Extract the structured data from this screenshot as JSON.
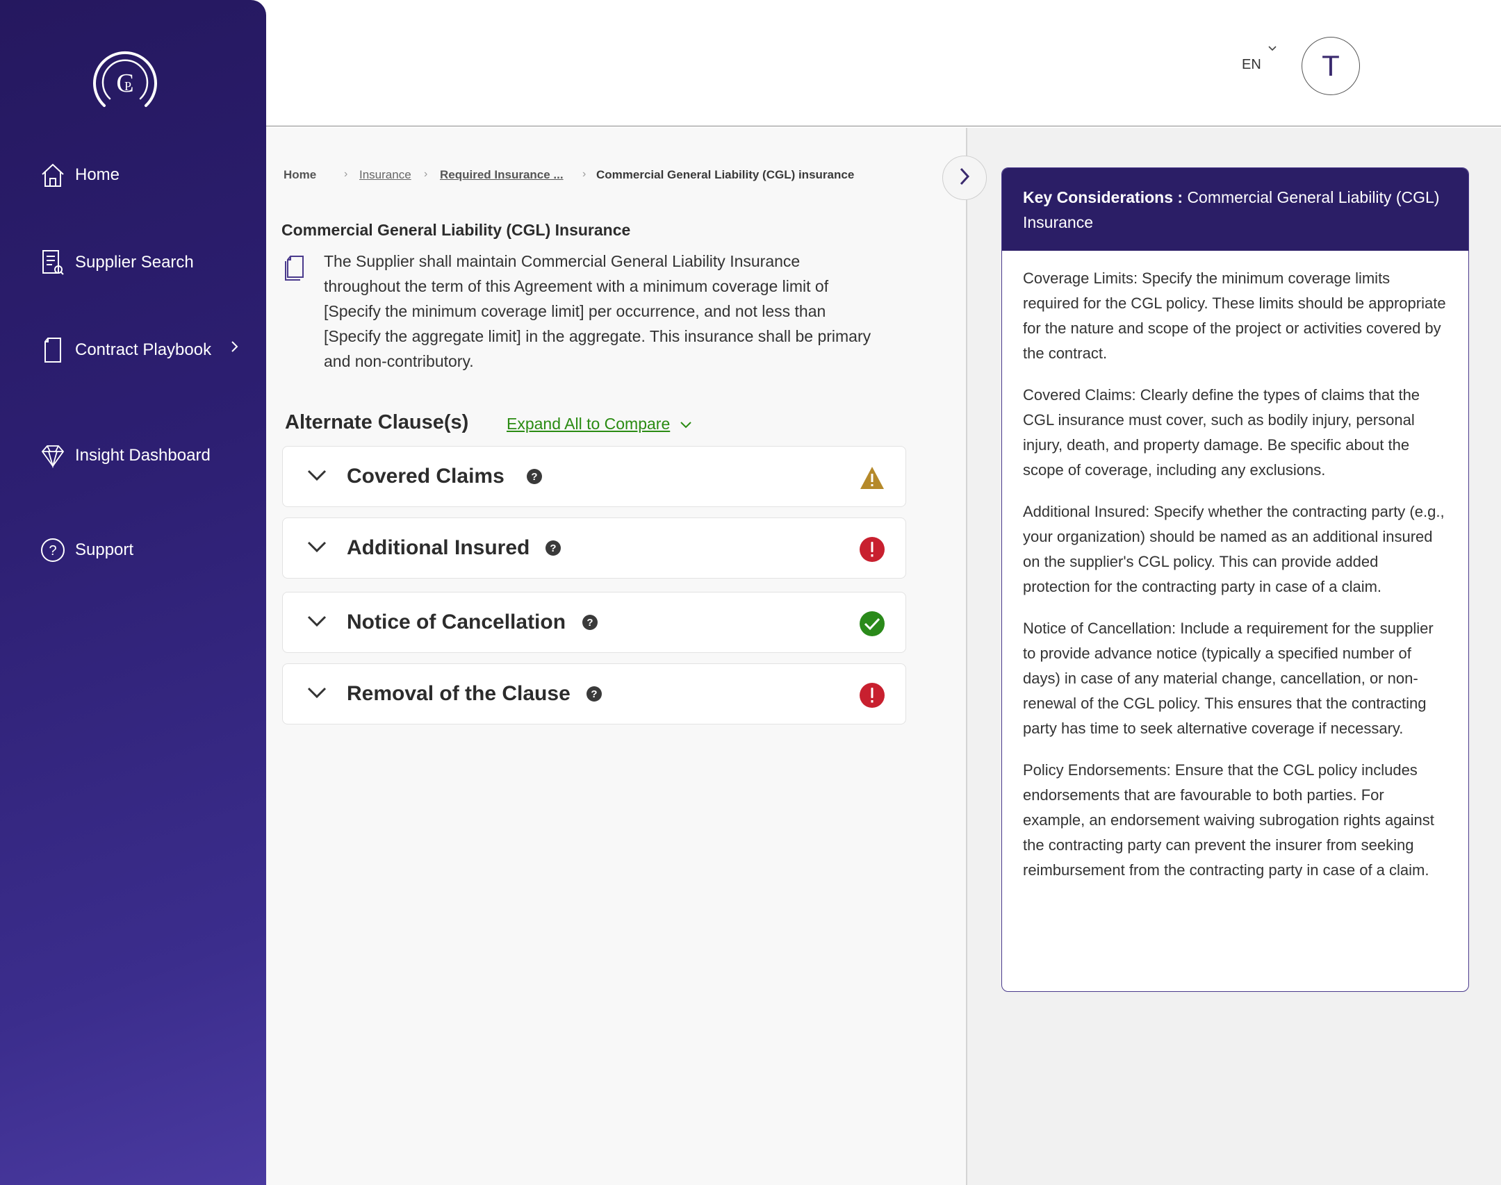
{
  "sidebar": {
    "logo_letters": "CP",
    "items": [
      {
        "label": "Home",
        "icon": "home-icon"
      },
      {
        "label": "Supplier Search",
        "icon": "supplier-search-icon"
      },
      {
        "label": "Contract Playbook",
        "icon": "document-icon",
        "has_submenu": true
      },
      {
        "label": "Insight Dashboard",
        "icon": "diamond-icon"
      },
      {
        "label": "Support",
        "icon": "help-circle-icon"
      }
    ]
  },
  "header": {
    "language": "EN",
    "avatar_initial": "T"
  },
  "breadcrumb": {
    "items": [
      "Home",
      "Insurance",
      "Required Insurance ...",
      "Commercial General Liability (CGL) insurance"
    ]
  },
  "clause": {
    "title": "Commercial General Liability (CGL) Insurance",
    "text": "The Supplier shall maintain Commercial General Liability Insurance throughout the term of this Agreement with a minimum coverage limit of [Specify the minimum coverage limit] per occurrence, and not less than [Specify the aggregate limit] in the aggregate. This insurance shall be primary and non-contributory."
  },
  "alternate": {
    "title": "Alternate Clause(s)",
    "expand_all_label": "Expand All to Compare",
    "items": [
      {
        "label": "Covered Claims",
        "status": "warning"
      },
      {
        "label": "Additional Insured",
        "status": "error"
      },
      {
        "label": "Notice of Cancellation",
        "status": "ok"
      },
      {
        "label": "Removal of the Clause",
        "status": "error"
      }
    ]
  },
  "key_considerations": {
    "label": "Key Considerations :",
    "subject": "Commercial General Liability (CGL) Insurance",
    "paragraphs": [
      "Coverage Limits: Specify the minimum coverage limits required for the CGL policy. These limits should be appropriate for the nature and scope of the project or activities covered by the contract.",
      "Covered Claims: Clearly define the types of claims that the CGL insurance must cover, such as bodily injury, personal injury, death, and property damage. Be specific about the scope of coverage, including any exclusions.",
      "Additional Insured: Specify whether the contracting party (e.g., your organization) should be named as an additional insured on the supplier's CGL policy. This can provide added protection for the contracting party in case of a claim.",
      "Notice of Cancellation: Include a requirement for the supplier to provide advance notice (typically a specified number of days) in case of any material change, cancellation, or non-renewal of the CGL policy. This ensures that the contracting party has time to seek alternative coverage if necessary.",
      "Policy Endorsements: Ensure that the CGL policy includes endorsements that are favourable to both parties. For example, an endorsement waiving subrogation rights against the contracting party can prevent the insurer from seeking reimbursement from the contracting party in case of a claim."
    ]
  },
  "colors": {
    "sidebar": "#2d1f72",
    "accent": "#2b1e66",
    "link_green": "#2a8b12",
    "warning": "#b5892a",
    "error": "#c8202f",
    "ok": "#2a8a1a"
  }
}
